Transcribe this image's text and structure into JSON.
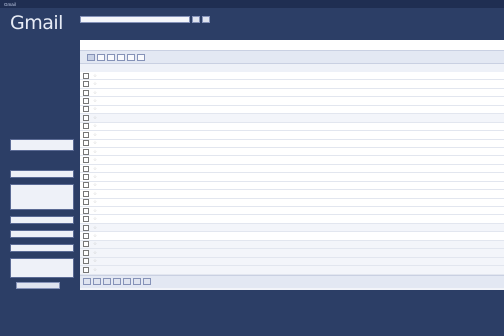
{
  "topbar": {
    "links": [
      "Gmail",
      "",
      "",
      "",
      "",
      "",
      ""
    ],
    "right": [
      "",
      "",
      "",
      ""
    ]
  },
  "logo": "Gmail",
  "search": {
    "query": "",
    "search_button": "",
    "web_button": "",
    "links": [
      "",
      ""
    ]
  },
  "sidebar": {
    "compose": "",
    "items": [
      {
        "label": "",
        "style": "normal"
      },
      {
        "label": "",
        "style": "normal"
      },
      {
        "label": "",
        "style": "normal"
      },
      {
        "label": "",
        "style": "normal"
      },
      {
        "label": "",
        "style": "normal"
      },
      {
        "label": "",
        "style": "normal"
      },
      {
        "label": "",
        "style": "normal"
      },
      {
        "label": "",
        "style": "dim"
      },
      {
        "label": "",
        "style": "normal"
      }
    ],
    "boxes": [
      {
        "head": "",
        "lines": [
          ""
        ]
      },
      {
        "head": "",
        "lines": []
      },
      {
        "head": "",
        "lines": [
          "",
          ""
        ]
      },
      {
        "head": "",
        "lines": []
      },
      {
        "head": "",
        "lines": []
      },
      {
        "head": "",
        "lines": []
      },
      {
        "head": "",
        "lines": [
          "",
          ""
        ]
      }
    ],
    "invite_button": "",
    "invites_left": ""
  },
  "main": {
    "infobar_text": "",
    "infobar_right": "",
    "toolbar_label": "",
    "toolbar_buttons": [
      "",
      "",
      "",
      "",
      "",
      "",
      "",
      ""
    ],
    "pager": "",
    "select_text": "",
    "rows": [
      {
        "sender": "",
        "tag": "",
        "subject": "",
        "date": "",
        "unread": true
      },
      {
        "sender": "",
        "tag": "",
        "subject": "",
        "date": "",
        "unread": true
      },
      {
        "sender": "",
        "tag": "",
        "subject": "",
        "date": "",
        "unread": true
      },
      {
        "sender": "",
        "tag": "",
        "subject": "",
        "date": "",
        "unread": true
      },
      {
        "sender": "",
        "tag": "",
        "subject": "",
        "date": "",
        "unread": true
      },
      {
        "sender": "",
        "tag": "",
        "subject": "",
        "date": "",
        "unread": false
      },
      {
        "sender": "",
        "tag": "",
        "subject": "",
        "date": "",
        "unread": true
      },
      {
        "sender": "",
        "tag": "",
        "subject": "",
        "date": "",
        "unread": true
      },
      {
        "sender": "",
        "tag": "",
        "subject": "",
        "date": "",
        "unread": true
      },
      {
        "sender": "",
        "tag": "",
        "subject": "",
        "date": "",
        "unread": true
      },
      {
        "sender": "",
        "tag": "",
        "subject": "",
        "date": "",
        "unread": true
      },
      {
        "sender": "",
        "tag": "",
        "subject": "",
        "date": "",
        "unread": true
      },
      {
        "sender": "",
        "tag": "",
        "subject": "",
        "date": "",
        "unread": true
      },
      {
        "sender": "",
        "tag": "",
        "subject": "",
        "date": "",
        "unread": true
      },
      {
        "sender": "",
        "tag": "",
        "subject": "",
        "date": "",
        "unread": true
      },
      {
        "sender": "",
        "tag": "",
        "subject": "",
        "date": "",
        "unread": true
      },
      {
        "sender": "",
        "tag": "",
        "subject": "",
        "date": "",
        "unread": true
      },
      {
        "sender": "",
        "tag": "",
        "subject": "",
        "date": "",
        "unread": true
      },
      {
        "sender": "",
        "tag": "",
        "subject": "",
        "date": "",
        "unread": false
      },
      {
        "sender": "",
        "tag": "",
        "subject": "",
        "date": "",
        "unread": true
      },
      {
        "sender": "",
        "tag": "",
        "subject": "",
        "date": "",
        "unread": false
      },
      {
        "sender": "",
        "tag": "",
        "subject": "",
        "date": "",
        "unread": false
      },
      {
        "sender": "",
        "tag": "",
        "subject": "",
        "date": "",
        "unread": false
      },
      {
        "sender": "",
        "tag": "",
        "subject": "",
        "date": "",
        "unread": false
      }
    ],
    "bottom_buttons": [
      "",
      "",
      "",
      "",
      "",
      "",
      ""
    ],
    "bottom_pager": ""
  },
  "footer": {
    "line1": "",
    "line2": "",
    "line3": "",
    "line4": ""
  }
}
